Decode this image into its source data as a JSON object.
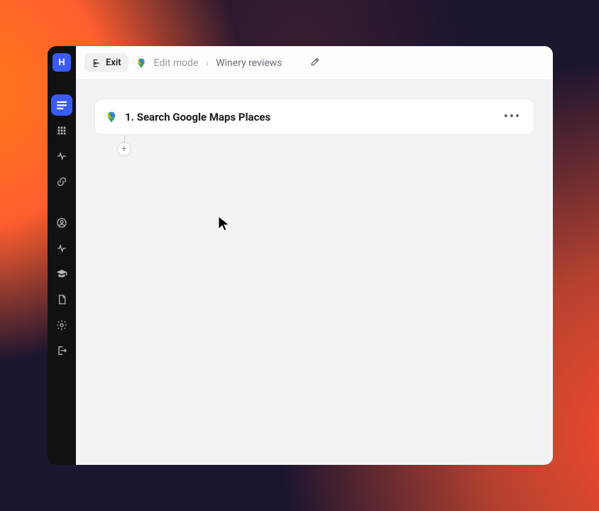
{
  "sidebar": {
    "logo_letter": "H",
    "items": [
      {
        "id": "workflows",
        "active": true
      },
      {
        "id": "apps"
      },
      {
        "id": "stats"
      },
      {
        "id": "connections"
      },
      {
        "id": "account"
      },
      {
        "id": "activity"
      },
      {
        "id": "learn"
      },
      {
        "id": "docs"
      },
      {
        "id": "settings"
      },
      {
        "id": "logout"
      }
    ]
  },
  "topbar": {
    "exit_label": "Exit",
    "mode_label": "Edit mode",
    "breadcrumb_sep": "›",
    "current_title": "Winery reviews"
  },
  "steps": [
    {
      "index": "1.",
      "title": "Search Google Maps Places"
    }
  ],
  "add_button_label": "+"
}
